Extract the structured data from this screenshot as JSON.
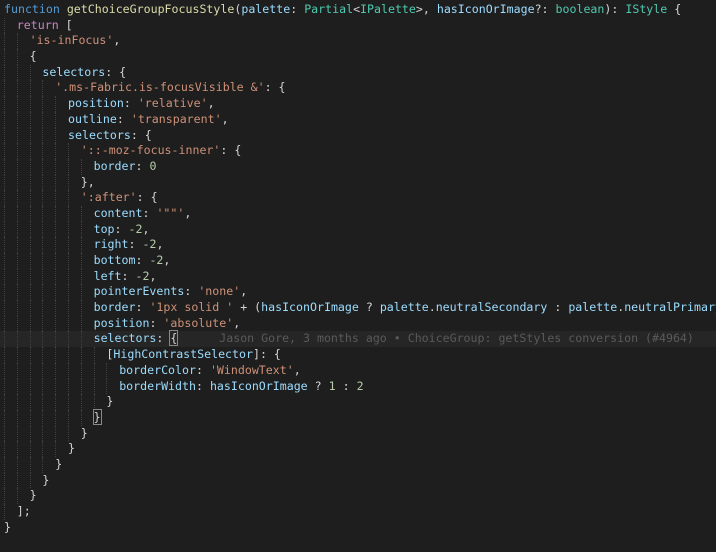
{
  "colors": {
    "background": "#1e1e1e",
    "keyword": "#569cd6",
    "control": "#c586c0",
    "function": "#dcdcaa",
    "parameter": "#9cdcfe",
    "type": "#4ec9b0",
    "string": "#ce9178",
    "number": "#b5cea8",
    "punctuation": "#d4d4d4",
    "blame": "#5a5a5a"
  },
  "editor": {
    "lines": [
      {
        "indent": 0,
        "tokens": [
          {
            "t": "function",
            "c": "kw"
          },
          {
            "t": " ",
            "c": "pun"
          },
          {
            "t": "getChoiceGroupFocusStyle",
            "c": "fn"
          },
          {
            "t": "(",
            "c": "pun"
          },
          {
            "t": "palette",
            "c": "prm"
          },
          {
            "t": ": ",
            "c": "pun"
          },
          {
            "t": "Partial",
            "c": "typ"
          },
          {
            "t": "<",
            "c": "pun"
          },
          {
            "t": "IPalette",
            "c": "typ"
          },
          {
            "t": ">, ",
            "c": "pun"
          },
          {
            "t": "hasIconOrImage",
            "c": "prm"
          },
          {
            "t": "?: ",
            "c": "pun"
          },
          {
            "t": "boolean",
            "c": "typ"
          },
          {
            "t": "): ",
            "c": "pun"
          },
          {
            "t": "IStyle",
            "c": "typ"
          },
          {
            "t": " {",
            "c": "pun"
          }
        ]
      },
      {
        "indent": 1,
        "tokens": [
          {
            "t": "return",
            "c": "ctl"
          },
          {
            "t": " [",
            "c": "pun"
          }
        ]
      },
      {
        "indent": 2,
        "tokens": [
          {
            "t": "'is-inFocus'",
            "c": "str"
          },
          {
            "t": ",",
            "c": "pun"
          }
        ]
      },
      {
        "indent": 2,
        "tokens": [
          {
            "t": "{",
            "c": "pun"
          }
        ]
      },
      {
        "indent": 3,
        "tokens": [
          {
            "t": "selectors",
            "c": "prop"
          },
          {
            "t": ": {",
            "c": "pun"
          }
        ]
      },
      {
        "indent": 4,
        "tokens": [
          {
            "t": "'.ms-Fabric.is-focusVisible &'",
            "c": "str"
          },
          {
            "t": ": {",
            "c": "pun"
          }
        ]
      },
      {
        "indent": 5,
        "tokens": [
          {
            "t": "position",
            "c": "prop"
          },
          {
            "t": ": ",
            "c": "pun"
          },
          {
            "t": "'relative'",
            "c": "str"
          },
          {
            "t": ",",
            "c": "pun"
          }
        ]
      },
      {
        "indent": 5,
        "tokens": [
          {
            "t": "outline",
            "c": "prop"
          },
          {
            "t": ": ",
            "c": "pun"
          },
          {
            "t": "'transparent'",
            "c": "str"
          },
          {
            "t": ",",
            "c": "pun"
          }
        ]
      },
      {
        "indent": 5,
        "tokens": [
          {
            "t": "selectors",
            "c": "prop"
          },
          {
            "t": ": {",
            "c": "pun"
          }
        ]
      },
      {
        "indent": 6,
        "tokens": [
          {
            "t": "'::-moz-focus-inner'",
            "c": "str"
          },
          {
            "t": ": {",
            "c": "pun"
          }
        ]
      },
      {
        "indent": 7,
        "tokens": [
          {
            "t": "border",
            "c": "prop"
          },
          {
            "t": ": ",
            "c": "pun"
          },
          {
            "t": "0",
            "c": "num"
          }
        ]
      },
      {
        "indent": 6,
        "tokens": [
          {
            "t": "},",
            "c": "pun"
          }
        ]
      },
      {
        "indent": 6,
        "tokens": [
          {
            "t": "':after'",
            "c": "str"
          },
          {
            "t": ": {",
            "c": "pun"
          }
        ]
      },
      {
        "indent": 7,
        "tokens": [
          {
            "t": "content",
            "c": "prop"
          },
          {
            "t": ": ",
            "c": "pun"
          },
          {
            "t": "'\"\"'",
            "c": "str"
          },
          {
            "t": ",",
            "c": "pun"
          }
        ]
      },
      {
        "indent": 7,
        "tokens": [
          {
            "t": "top",
            "c": "prop"
          },
          {
            "t": ": ",
            "c": "pun"
          },
          {
            "t": "-2",
            "c": "num"
          },
          {
            "t": ",",
            "c": "pun"
          }
        ]
      },
      {
        "indent": 7,
        "tokens": [
          {
            "t": "right",
            "c": "prop"
          },
          {
            "t": ": ",
            "c": "pun"
          },
          {
            "t": "-2",
            "c": "num"
          },
          {
            "t": ",",
            "c": "pun"
          }
        ]
      },
      {
        "indent": 7,
        "tokens": [
          {
            "t": "bottom",
            "c": "prop"
          },
          {
            "t": ": ",
            "c": "pun"
          },
          {
            "t": "-2",
            "c": "num"
          },
          {
            "t": ",",
            "c": "pun"
          }
        ]
      },
      {
        "indent": 7,
        "tokens": [
          {
            "t": "left",
            "c": "prop"
          },
          {
            "t": ": ",
            "c": "pun"
          },
          {
            "t": "-2",
            "c": "num"
          },
          {
            "t": ",",
            "c": "pun"
          }
        ]
      },
      {
        "indent": 7,
        "tokens": [
          {
            "t": "pointerEvents",
            "c": "prop"
          },
          {
            "t": ": ",
            "c": "pun"
          },
          {
            "t": "'none'",
            "c": "str"
          },
          {
            "t": ",",
            "c": "pun"
          }
        ]
      },
      {
        "indent": 7,
        "tokens": [
          {
            "t": "border",
            "c": "prop"
          },
          {
            "t": ": ",
            "c": "pun"
          },
          {
            "t": "'1px solid '",
            "c": "str"
          },
          {
            "t": " + (",
            "c": "pun"
          },
          {
            "t": "hasIconOrImage",
            "c": "prm"
          },
          {
            "t": " ? ",
            "c": "pun"
          },
          {
            "t": "palette",
            "c": "prm"
          },
          {
            "t": ".",
            "c": "pun"
          },
          {
            "t": "neutralSecondary",
            "c": "prop"
          },
          {
            "t": " : ",
            "c": "pun"
          },
          {
            "t": "palette",
            "c": "prm"
          },
          {
            "t": ".",
            "c": "pun"
          },
          {
            "t": "neutralPrimary",
            "c": "prop"
          },
          {
            "t": "),",
            "c": "pun"
          }
        ]
      },
      {
        "indent": 7,
        "tokens": [
          {
            "t": "position",
            "c": "prop"
          },
          {
            "t": ": ",
            "c": "pun"
          },
          {
            "t": "'absolute'",
            "c": "str"
          },
          {
            "t": ",",
            "c": "pun"
          }
        ]
      },
      {
        "indent": 7,
        "current": true,
        "tokens": [
          {
            "t": "selectors",
            "c": "prop"
          },
          {
            "t": ": ",
            "c": "pun"
          },
          {
            "t": "{",
            "c": "brk"
          },
          {
            "t": "      Jason Gore, 3 months ago • ChoiceGroup: getStyles conversion (#4964)",
            "c": "blame"
          }
        ]
      },
      {
        "indent": 8,
        "tokens": [
          {
            "t": "[",
            "c": "pun"
          },
          {
            "t": "HighContrastSelector",
            "c": "prm"
          },
          {
            "t": "]: {",
            "c": "pun"
          }
        ]
      },
      {
        "indent": 9,
        "tokens": [
          {
            "t": "borderColor",
            "c": "prop"
          },
          {
            "t": ": ",
            "c": "pun"
          },
          {
            "t": "'WindowText'",
            "c": "str"
          },
          {
            "t": ",",
            "c": "pun"
          }
        ]
      },
      {
        "indent": 9,
        "tokens": [
          {
            "t": "borderWidth",
            "c": "prop"
          },
          {
            "t": ": ",
            "c": "pun"
          },
          {
            "t": "hasIconOrImage",
            "c": "prm"
          },
          {
            "t": " ? ",
            "c": "pun"
          },
          {
            "t": "1",
            "c": "num"
          },
          {
            "t": " : ",
            "c": "pun"
          },
          {
            "t": "2",
            "c": "num"
          }
        ]
      },
      {
        "indent": 8,
        "tokens": [
          {
            "t": "}",
            "c": "pun"
          }
        ]
      },
      {
        "indent": 7,
        "tokens": [
          {
            "t": "}",
            "c": "brk"
          }
        ]
      },
      {
        "indent": 6,
        "tokens": [
          {
            "t": "}",
            "c": "pun"
          }
        ]
      },
      {
        "indent": 5,
        "tokens": [
          {
            "t": "}",
            "c": "pun"
          }
        ]
      },
      {
        "indent": 4,
        "tokens": [
          {
            "t": "}",
            "c": "pun"
          }
        ]
      },
      {
        "indent": 3,
        "tokens": [
          {
            "t": "}",
            "c": "pun"
          }
        ]
      },
      {
        "indent": 2,
        "tokens": [
          {
            "t": "}",
            "c": "pun"
          }
        ]
      },
      {
        "indent": 1,
        "tokens": [
          {
            "t": "];",
            "c": "pun"
          }
        ]
      },
      {
        "indent": 0,
        "tokens": [
          {
            "t": "}",
            "c": "pun"
          }
        ]
      }
    ]
  }
}
